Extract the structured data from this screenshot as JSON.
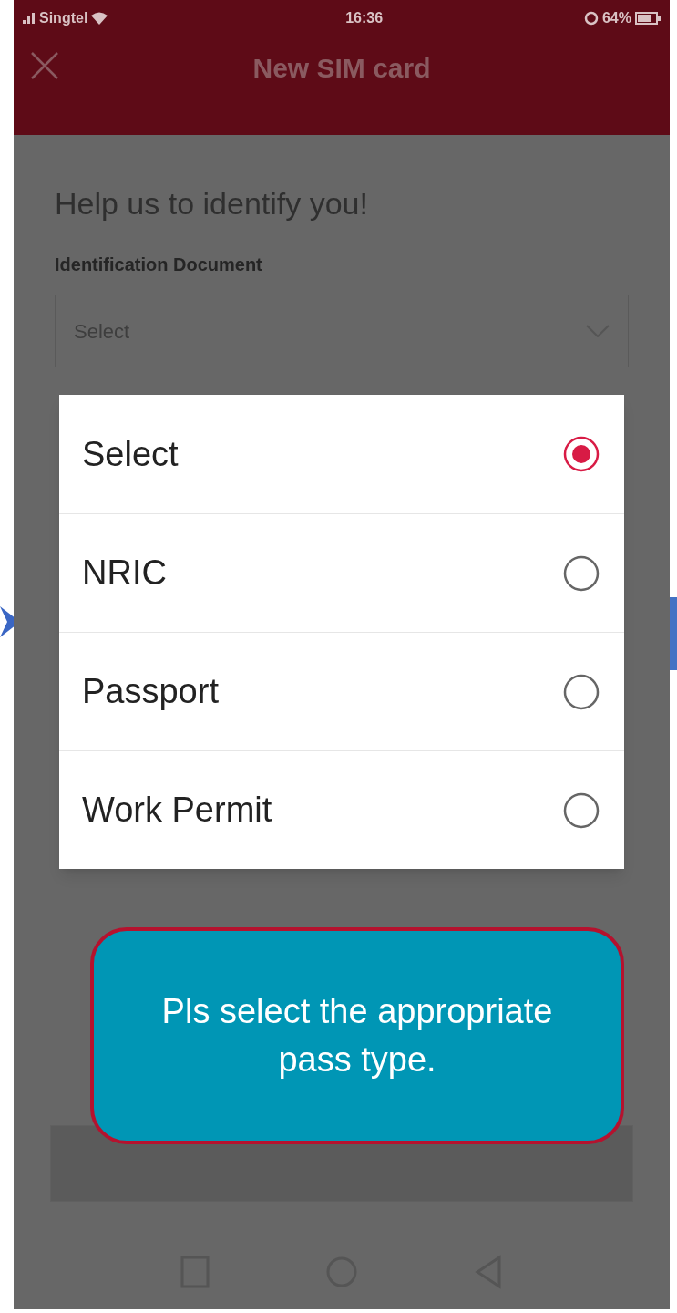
{
  "status_bar": {
    "carrier": "Singtel",
    "time": "16:36",
    "battery": "64%"
  },
  "header": {
    "title": "New SIM card"
  },
  "form": {
    "heading": "Help us to identify you!",
    "label": "Identification Document",
    "placeholder": "Select"
  },
  "dialog": {
    "options": [
      {
        "label": "Select",
        "selected": true
      },
      {
        "label": "NRIC",
        "selected": false
      },
      {
        "label": "Passport",
        "selected": false
      },
      {
        "label": "Work Permit",
        "selected": false
      }
    ]
  },
  "callout": {
    "text": "Pls select the appropriate pass type."
  }
}
